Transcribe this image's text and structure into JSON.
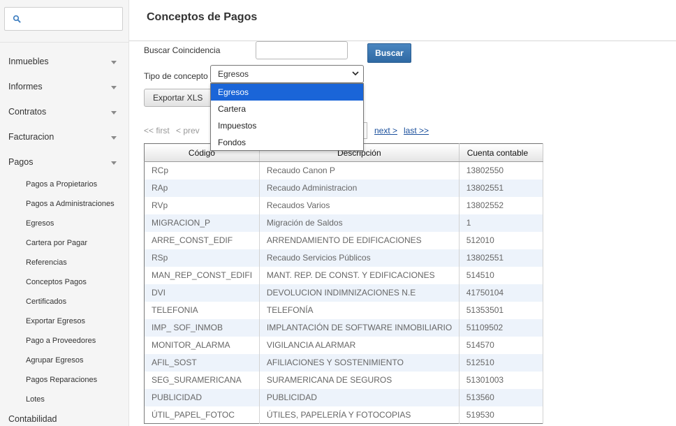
{
  "sidebar": {
    "search": {
      "value": "",
      "placeholder": ""
    },
    "menu": [
      {
        "label": "Inmuebles"
      },
      {
        "label": "Informes"
      },
      {
        "label": "Contratos"
      },
      {
        "label": "Facturacion"
      },
      {
        "label": "Pagos"
      }
    ],
    "pagos_submenu": [
      {
        "label": "Pagos a Propietarios"
      },
      {
        "label": "Pagos a Administraciones"
      },
      {
        "label": "Egresos"
      },
      {
        "label": "Cartera por Pagar"
      },
      {
        "label": "Referencias"
      },
      {
        "label": "Conceptos Pagos"
      },
      {
        "label": "Certificados"
      },
      {
        "label": "Exportar Egresos"
      },
      {
        "label": "Pago a Proveedores"
      },
      {
        "label": "Agrupar Egresos"
      },
      {
        "label": "Pagos Reparaciones"
      },
      {
        "label": "Lotes"
      }
    ],
    "trailing_item": "Contabilidad"
  },
  "page": {
    "title": "Conceptos de Pagos"
  },
  "filters": {
    "search_label": "Buscar Coincidencia",
    "search_value": "",
    "search_button": "Buscar",
    "tipo_label": "Tipo de concepto",
    "tipo_selected": "Egresos",
    "tipo_options": [
      "Egresos",
      "Cartera",
      "Impuestos",
      "Fondos"
    ],
    "export_button": "Exportar XLS"
  },
  "pager": {
    "first": "<< first",
    "prev": "< prev",
    "next": "next >",
    "last": "last >>"
  },
  "table": {
    "headers": [
      "Código",
      "Descripción",
      "Cuenta contable"
    ],
    "rows": [
      [
        "RCp",
        "Recaudo Canon P",
        "13802550"
      ],
      [
        "RAp",
        "Recaudo Administracion",
        "13802551"
      ],
      [
        "RVp",
        "Recaudos Varios",
        "13802552"
      ],
      [
        "MIGRACION_P",
        "Migración de Saldos",
        "1"
      ],
      [
        "ARRE_CONST_EDIF",
        "ARRENDAMIENTO DE EDIFICACIONES",
        "512010"
      ],
      [
        "RSp",
        "Recaudo Servicios Públicos",
        "13802551"
      ],
      [
        "MAN_REP_CONST_EDIFI",
        "MANT. REP. DE CONST. Y EDIFICACIONES",
        "514510"
      ],
      [
        "DVI",
        "DEVOLUCION INDIMNIZACIONES N.E",
        "41750104"
      ],
      [
        "TELEFONIA",
        "TELEFONÍA",
        "51353501"
      ],
      [
        "IMP_ SOF_INMOB",
        "IMPLANTACIÓN DE SOFTWARE INMOBILIARIO",
        "51109502"
      ],
      [
        "MONITOR_ALARMA",
        "VIGILANCIA ALARMAR",
        "514570"
      ],
      [
        "AFIL_SOST",
        "AFILIACIONES Y SOSTENIMIENTO",
        "512510"
      ],
      [
        "SEG_SURAMERICANA",
        "SURAMERICANA DE SEGUROS",
        "51301003"
      ],
      [
        "PUBLICIDAD",
        "PUBLICIDAD",
        "513560"
      ],
      [
        "ÚTIL_PAPEL_FOTOC",
        "ÚTILES, PAPELERÍA Y FOTOCOPIAS",
        "519530"
      ]
    ]
  },
  "colors": {
    "accent": "#2f69a3",
    "selected_option": "#1a65d8",
    "row_alt": "#edf3fb",
    "link": "#1a4f9c"
  }
}
